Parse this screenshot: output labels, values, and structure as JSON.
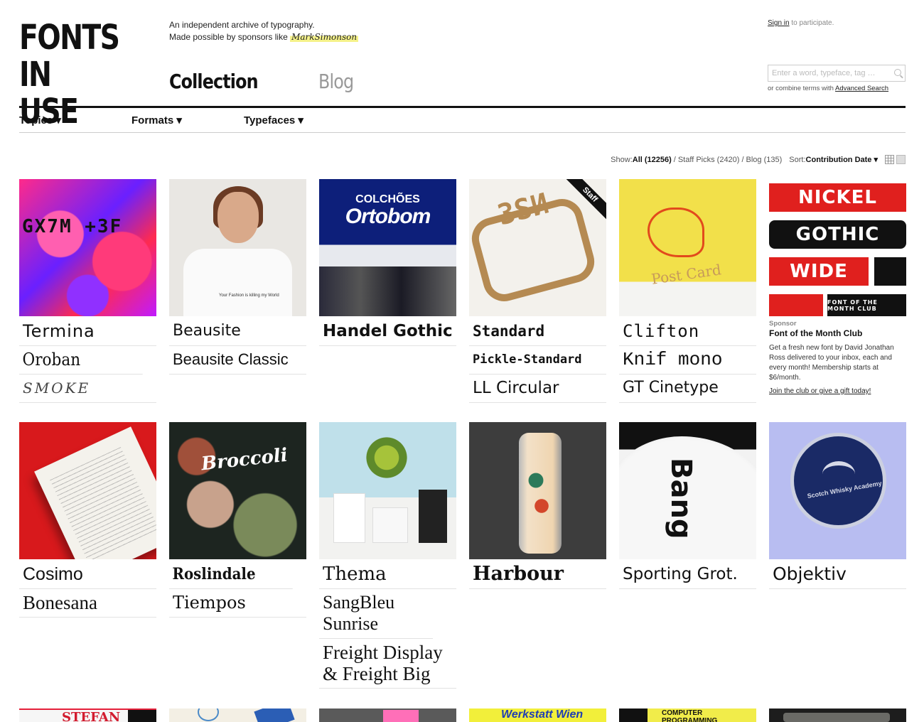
{
  "header": {
    "logo_line1": "FONTS",
    "logo_line2": "IN USE",
    "tagline_line1": "An independent archive of typography.",
    "tagline_line2": "Made possible by sponsors like",
    "tagline_sponsor": "MarkSimonson",
    "signin_link": "Sign in",
    "signin_rest": " to participate.",
    "search_placeholder": "Enter a word, typeface, tag …",
    "advanced_prefix": "or combine terms with ",
    "advanced_link": "Advanced Search",
    "nav_collection": "Collection",
    "nav_blog": "Blog"
  },
  "subnav": {
    "topics": "Topics ▾",
    "formats": "Formats ▾",
    "typefaces": "Typefaces ▾"
  },
  "filter": {
    "show_label": "Show: ",
    "all": "All (12256)",
    "staff": "Staff Picks (2420)",
    "blog": "Blog (135)",
    "sort_label": "Sort: ",
    "sort_value": "Contribution Date ▾"
  },
  "cards": [
    {
      "fonts": [
        "Termina",
        "Oroban",
        "SMOKE"
      ]
    },
    {
      "fonts": [
        "Beausite",
        "Beausite Classic"
      ]
    },
    {
      "fonts": [
        "Handel Gothic"
      ]
    },
    {
      "fonts": [
        "Standard",
        "Pickle-Standard",
        "LL Circular"
      ],
      "badge": "Staff Pick"
    },
    {
      "fonts": [
        "Clifton",
        "Knif mono",
        "GT Cinetype"
      ]
    },
    {
      "sponsor": true
    },
    {
      "fonts": [
        "Cosimo",
        "Bonesana"
      ]
    },
    {
      "fonts": [
        "Roslindale",
        "Tiempos"
      ]
    },
    {
      "fonts": [
        "Thema",
        "SangBleu Sunrise",
        "Freight Display & Freight Big"
      ]
    },
    {
      "fonts": [
        "Harbour"
      ]
    },
    {
      "fonts": [
        "Sporting Grot."
      ]
    },
    {
      "fonts": [
        "Objektiv"
      ]
    }
  ],
  "thumb_text": {
    "t1": "GX7M +3F",
    "t2": "Your Fashion is killing my World",
    "t3a": "COLCHÕES",
    "t3b": "Ortobom",
    "t4": "Staff",
    "t5": "Post Card",
    "t6a": "NICKEL",
    "t6b": "GOTHIC",
    "t6c": "WIDE",
    "t6d": "FONT OF THE MONTH CLUB",
    "t8": "Broccoli",
    "t11": "Bang",
    "t12": "Scotch Whisky Academy"
  },
  "sponsor": {
    "label": "Sponsor",
    "name": "Font of the Month Club",
    "description": "Get a fresh new font by David Jonathan Ross delivered to your inbox, each and every month! Membership starts at $6/month.",
    "cta": "Join the club or give a gift today!"
  },
  "row3_peeks": [
    "STEFAN",
    "",
    "",
    "Werkstatt Wien",
    "COMPUTER PROGRAMMING",
    ""
  ]
}
